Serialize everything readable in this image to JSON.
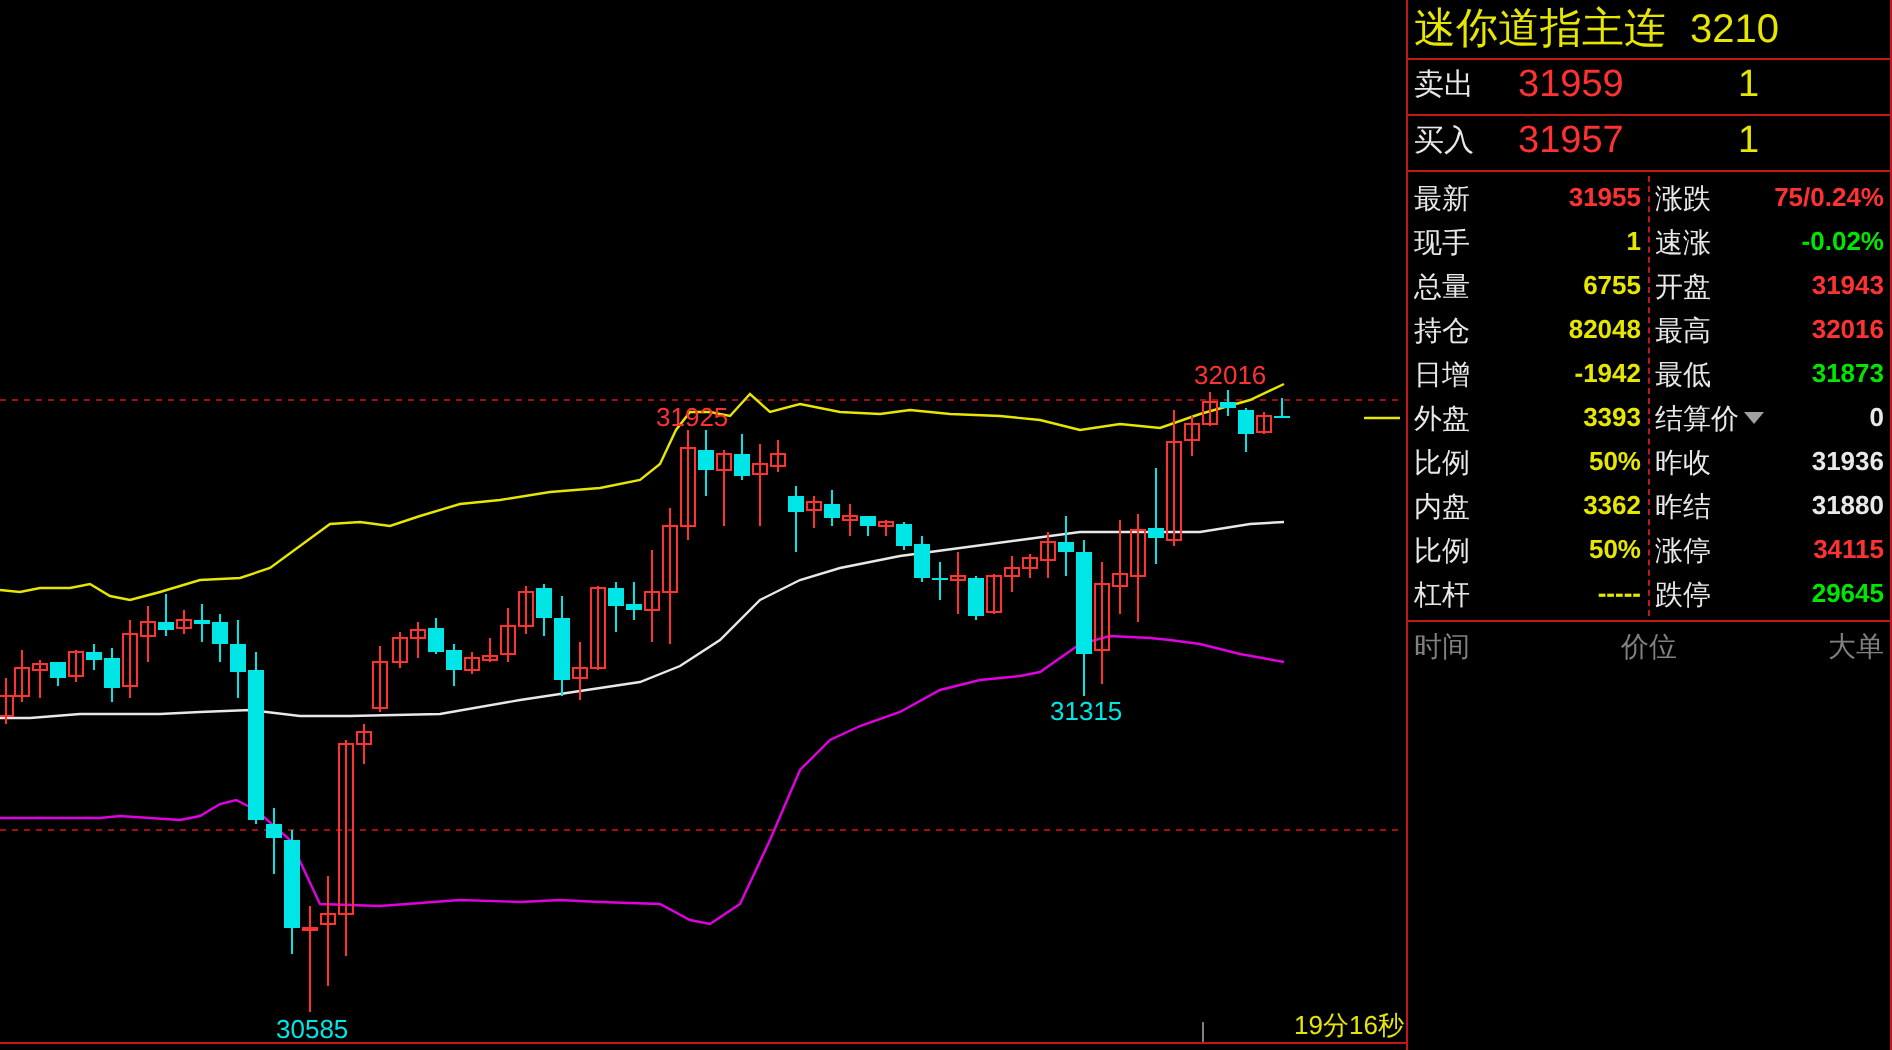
{
  "instrument": {
    "name": "迷你道指主连",
    "code": "3210"
  },
  "order_book": [
    {
      "side": "卖出",
      "price": "31959",
      "volume": "1"
    },
    {
      "side": "买入",
      "price": "31957",
      "volume": "1"
    }
  ],
  "quote_left": [
    {
      "label": "最新",
      "value": "31955",
      "color": "#ff3232"
    },
    {
      "label": "现手",
      "value": "1",
      "color": "#e6e600"
    },
    {
      "label": "总量",
      "value": "6755",
      "color": "#e6e600"
    },
    {
      "label": "持仓",
      "value": "82048",
      "color": "#e6e600"
    },
    {
      "label": "日增",
      "value": "-1942",
      "color": "#e6e600"
    },
    {
      "label": "外盘",
      "value": "3393",
      "color": "#e6e600"
    },
    {
      "label": "比例",
      "value": "50%",
      "color": "#e6e600"
    },
    {
      "label": "内盘",
      "value": "3362",
      "color": "#e6e600"
    },
    {
      "label": "比例",
      "value": "50%",
      "color": "#e6e600"
    },
    {
      "label": "杠杆",
      "value": "-----",
      "color": "#e6e600"
    }
  ],
  "quote_right": [
    {
      "label": "涨跌",
      "value": "75/0.24%",
      "color": "#ff3232",
      "dropdown": false
    },
    {
      "label": "速涨",
      "value": "-0.02%",
      "color": "#00e600",
      "dropdown": false
    },
    {
      "label": "开盘",
      "value": "31943",
      "color": "#ff3232",
      "dropdown": false
    },
    {
      "label": "最高",
      "value": "32016",
      "color": "#ff3232",
      "dropdown": false
    },
    {
      "label": "最低",
      "value": "31873",
      "color": "#00e600",
      "dropdown": false
    },
    {
      "label": "结算价",
      "value": "0",
      "color": "#e8e8e8",
      "dropdown": true
    },
    {
      "label": "昨收",
      "value": "31936",
      "color": "#e8e8e8",
      "dropdown": false
    },
    {
      "label": "昨结",
      "value": "31880",
      "color": "#e8e8e8",
      "dropdown": false
    },
    {
      "label": "涨停",
      "value": "34115",
      "color": "#ff3232",
      "dropdown": false
    },
    {
      "label": "跌停",
      "value": "29645",
      "color": "#00e600",
      "dropdown": false
    }
  ],
  "ticks_columns": [
    "时间",
    "价位",
    "大单"
  ],
  "chart": {
    "labels": [
      {
        "text": "31925",
        "color": "#ff3232"
      },
      {
        "text": "32016",
        "color": "#ff3232"
      },
      {
        "text": "31315",
        "color": "#00e5e5"
      },
      {
        "text": "30585",
        "color": "#00e5e5"
      }
    ],
    "timer": "19分16秒"
  }
}
